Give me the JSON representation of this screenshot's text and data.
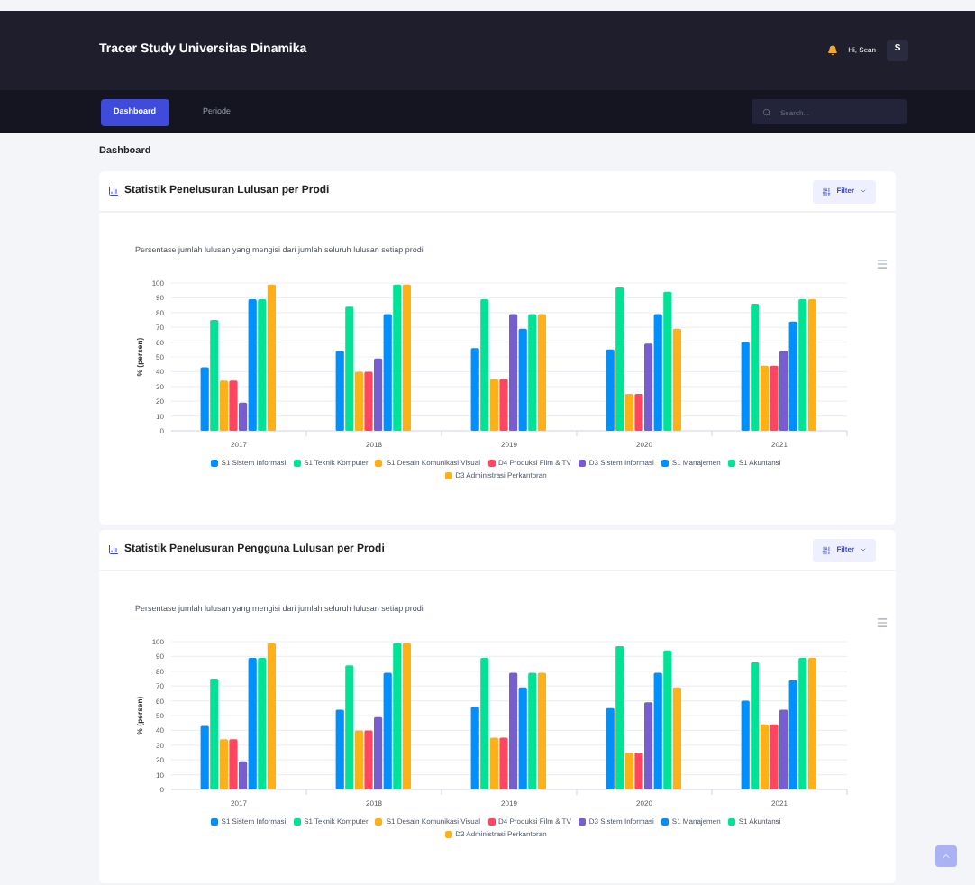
{
  "app_title": "Tracer Study Universitas Dinamika",
  "user": {
    "greeting": "Hi, Sean",
    "initial": "S"
  },
  "nav": [
    {
      "label": "Dashboard",
      "selected": true
    },
    {
      "label": "Periode",
      "selected": false
    }
  ],
  "search": {
    "placeholder": "Search..."
  },
  "breadcrumb": "Dashboard",
  "cards": [
    {
      "title": "Statistik Penelusuran Lulusan per Prodi",
      "filter": "Filter",
      "chart_data": {
        "type": "bar",
        "grid": true,
        "legend": true,
        "title": "Persentase jumlah lulusan yang mengisi dari jumlah seluruh lulusan setiap prodi",
        "ylabel": "% (persen)",
        "categories": [
          "2017",
          "2018",
          "2019",
          "2020",
          "2021"
        ],
        "ylim": [
          0,
          100
        ],
        "yticks": [
          0,
          10,
          20,
          30,
          40,
          50,
          60,
          70,
          80,
          90,
          100
        ],
        "series": [
          {
            "name": "S1 Sistem Informasi",
            "color": "#008ffb",
            "values": [
              43,
              54,
              56,
              55,
              60
            ]
          },
          {
            "name": "S1 Teknik Komputer",
            "color": "#00e396",
            "values": [
              75,
              84,
              89,
              97,
              86
            ]
          },
          {
            "name": "S1 Desain Komunikasi Visual",
            "color": "#feb019",
            "values": [
              34,
              40,
              35,
              25,
              44
            ]
          },
          {
            "name": "D4 Produksi Film & TV",
            "color": "#ff4560",
            "values": [
              34,
              40,
              35,
              25,
              44
            ]
          },
          {
            "name": "D3 Sistem Informasi",
            "color": "#775dd0",
            "values": [
              19,
              49,
              79,
              59,
              54
            ]
          },
          {
            "name": "S1 Manajemen",
            "color": "#008ffb",
            "values": [
              89,
              79,
              69,
              79,
              74
            ]
          },
          {
            "name": "S1 Akuntansi",
            "color": "#00e396",
            "values": [
              89,
              99,
              79,
              94,
              89
            ]
          },
          {
            "name": "D3 Administrasi Perkantoran",
            "color": "#feb019",
            "values": [
              99,
              99,
              79,
              69,
              89
            ]
          }
        ]
      }
    },
    {
      "title": "Statistik Penelusuran Pengguna Lulusan per Prodi",
      "filter": "Filter",
      "chart_data": {
        "type": "bar",
        "grid": true,
        "legend": true,
        "title": "Persentase jumlah lulusan yang mengisi dari jumlah seluruh lulusan setiap prodi",
        "ylabel": "% (persen)",
        "categories": [
          "2017",
          "2018",
          "2019",
          "2020",
          "2021"
        ],
        "ylim": [
          0,
          100
        ],
        "yticks": [
          0,
          10,
          20,
          30,
          40,
          50,
          60,
          70,
          80,
          90,
          100
        ],
        "series": [
          {
            "name": "S1 Sistem Informasi",
            "color": "#008ffb",
            "values": [
              43,
              54,
              56,
              55,
              60
            ]
          },
          {
            "name": "S1 Teknik Komputer",
            "color": "#00e396",
            "values": [
              75,
              84,
              89,
              97,
              86
            ]
          },
          {
            "name": "S1 Desain Komunikasi Visual",
            "color": "#feb019",
            "values": [
              34,
              40,
              35,
              25,
              44
            ]
          },
          {
            "name": "D4 Produksi Film & TV",
            "color": "#ff4560",
            "values": [
              34,
              40,
              35,
              25,
              44
            ]
          },
          {
            "name": "D3 Sistem Informasi",
            "color": "#775dd0",
            "values": [
              19,
              49,
              79,
              59,
              54
            ]
          },
          {
            "name": "S1 Manajemen",
            "color": "#008ffb",
            "values": [
              89,
              79,
              69,
              79,
              74
            ]
          },
          {
            "name": "S1 Akuntansi",
            "color": "#00e396",
            "values": [
              89,
              99,
              79,
              94,
              89
            ]
          },
          {
            "name": "D3 Administrasi Perkantoran",
            "color": "#feb019",
            "values": [
              99,
              99,
              79,
              69,
              89
            ]
          }
        ]
      }
    }
  ]
}
